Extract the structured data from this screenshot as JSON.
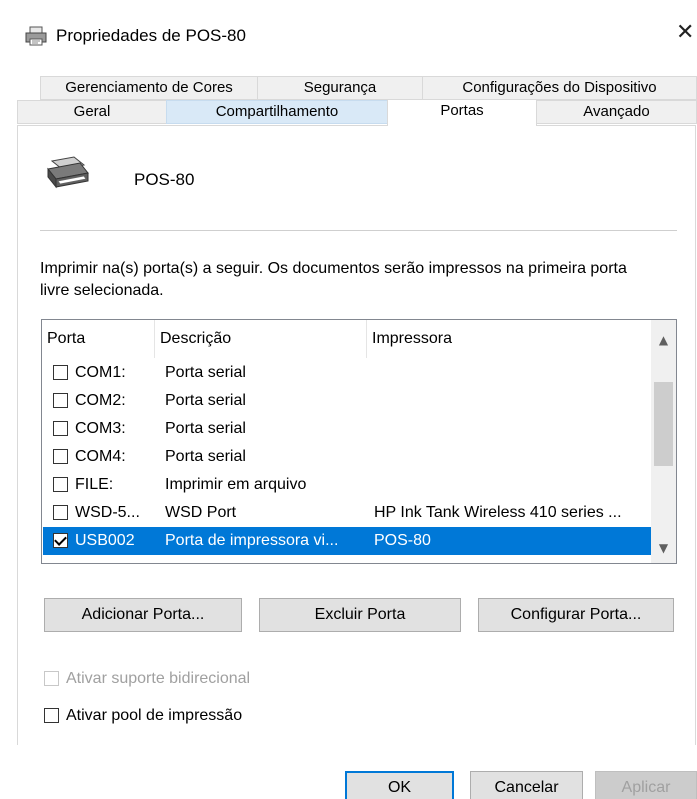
{
  "window": {
    "title": "Propriedades de POS-80",
    "close_glyph": "✕"
  },
  "tabs": {
    "row1": [
      {
        "label": "Gerenciamento de Cores"
      },
      {
        "label": "Segurança"
      },
      {
        "label": "Configurações do Dispositivo"
      }
    ],
    "row2": [
      {
        "label": "Geral"
      },
      {
        "label": "Compartilhamento"
      },
      {
        "label": "Portas"
      },
      {
        "label": "Avançado"
      }
    ],
    "active": "Portas"
  },
  "printer": {
    "name": "POS-80"
  },
  "description": "Imprimir na(s) porta(s) a seguir. Os documentos serão impressos na primeira porta livre selecionada.",
  "ports_table": {
    "headers": [
      "Porta",
      "Descrição",
      "Impressora"
    ],
    "rows": [
      {
        "port": "COM1:",
        "description": "Porta serial",
        "printer": "",
        "checked": false
      },
      {
        "port": "COM2:",
        "description": "Porta serial",
        "printer": "",
        "checked": false
      },
      {
        "port": "COM3:",
        "description": "Porta serial",
        "printer": "",
        "checked": false
      },
      {
        "port": "COM4:",
        "description": "Porta serial",
        "printer": "",
        "checked": false
      },
      {
        "port": "FILE:",
        "description": "Imprimir em arquivo",
        "printer": "",
        "checked": false
      },
      {
        "port": "WSD-5...",
        "description": "WSD Port",
        "printer": "HP Ink Tank Wireless 410 series ...",
        "checked": false
      },
      {
        "port": "USB002",
        "description": "Porta de impressora vi...",
        "printer": "POS-80",
        "checked": true,
        "selected": true
      }
    ]
  },
  "buttons": {
    "add_port": "Adicionar Porta...",
    "delete_port": "Excluir Porta",
    "configure_port": "Configurar Porta..."
  },
  "options": {
    "bidirectional": {
      "label": "Ativar suporte bidirecional",
      "checked": false,
      "disabled": true
    },
    "pooling": {
      "label": "Ativar pool de impressão",
      "checked": false,
      "disabled": false
    }
  },
  "footer": {
    "ok": "OK",
    "cancel": "Cancelar",
    "apply": "Aplicar"
  },
  "colors": {
    "selection": "#0078d7",
    "tab_hover": "#d9e9f7"
  },
  "icons": {
    "title": "printer-icon",
    "printer": "printer-icon",
    "scroll_up": "chevron-up-icon",
    "scroll_down": "chevron-down-icon"
  }
}
